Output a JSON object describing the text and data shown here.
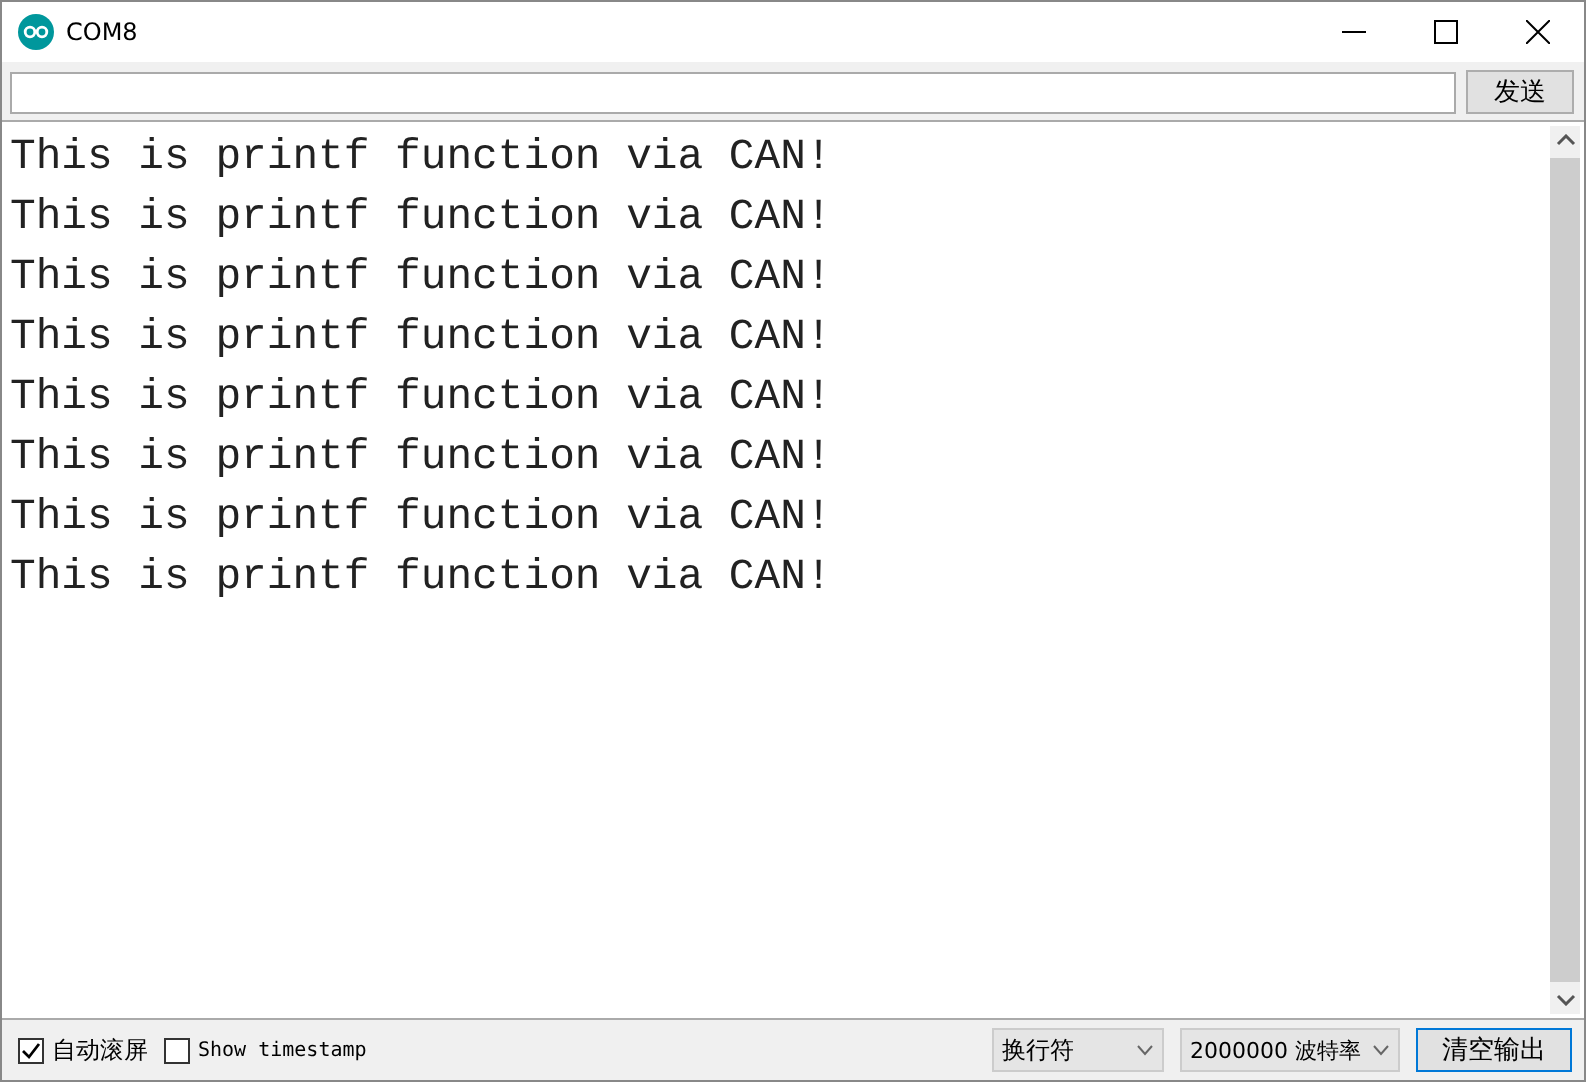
{
  "window": {
    "title": "COM8"
  },
  "send_bar": {
    "button": "发送"
  },
  "output": {
    "lines": [
      "This is printf function via CAN!",
      "This is printf function via CAN!",
      "This is printf function via CAN!",
      "This is printf function via CAN!",
      "This is printf function via CAN!",
      "This is printf function via CAN!",
      "This is printf function via CAN!",
      "This is printf function via CAN!"
    ]
  },
  "status_bar": {
    "autoscroll": {
      "label": "自动滚屏",
      "checked": true
    },
    "timestamp": {
      "label": "Show timestamp",
      "checked": false
    },
    "line_ending": "换行符",
    "baud_rate": "2000000 波特率",
    "clear_button": "清空输出"
  }
}
